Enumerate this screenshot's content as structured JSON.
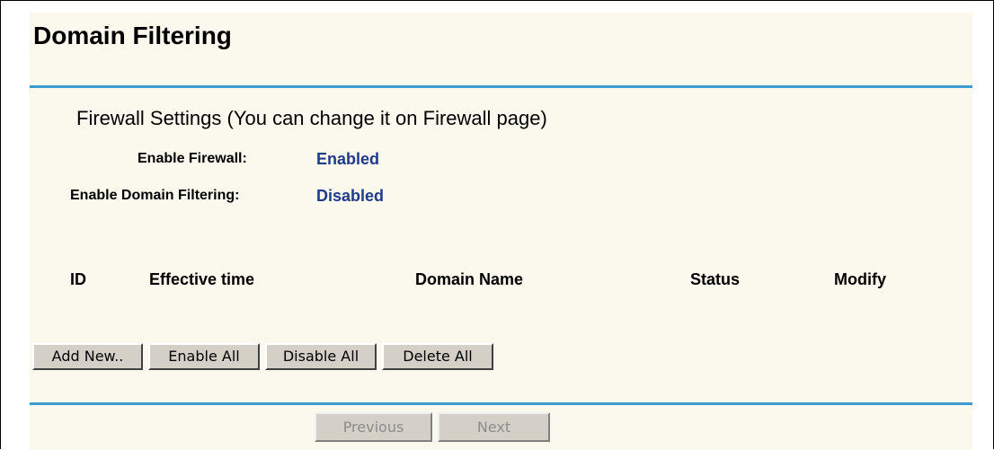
{
  "page": {
    "title": "Domain Filtering"
  },
  "firewall": {
    "section_title": "Firewall Settings (You can change it on Firewall page)",
    "enable_firewall_label": "Enable Firewall:",
    "enable_firewall_value": "Enabled",
    "enable_domain_filtering_label": "Enable Domain Filtering:",
    "enable_domain_filtering_value": "Disabled"
  },
  "table": {
    "columns": [
      "ID",
      "Effective time",
      "Domain Name",
      "Status",
      "Modify"
    ],
    "rows": []
  },
  "actions": {
    "add_new": "Add New..",
    "enable_all": "Enable All",
    "disable_all": "Disable All",
    "delete_all": "Delete All"
  },
  "pagination": {
    "previous": "Previous",
    "next": "Next"
  },
  "colors": {
    "accent_rule": "#3c9bd3",
    "panel_background": "#fbf8ee",
    "status_value": "#1f3a8a"
  }
}
